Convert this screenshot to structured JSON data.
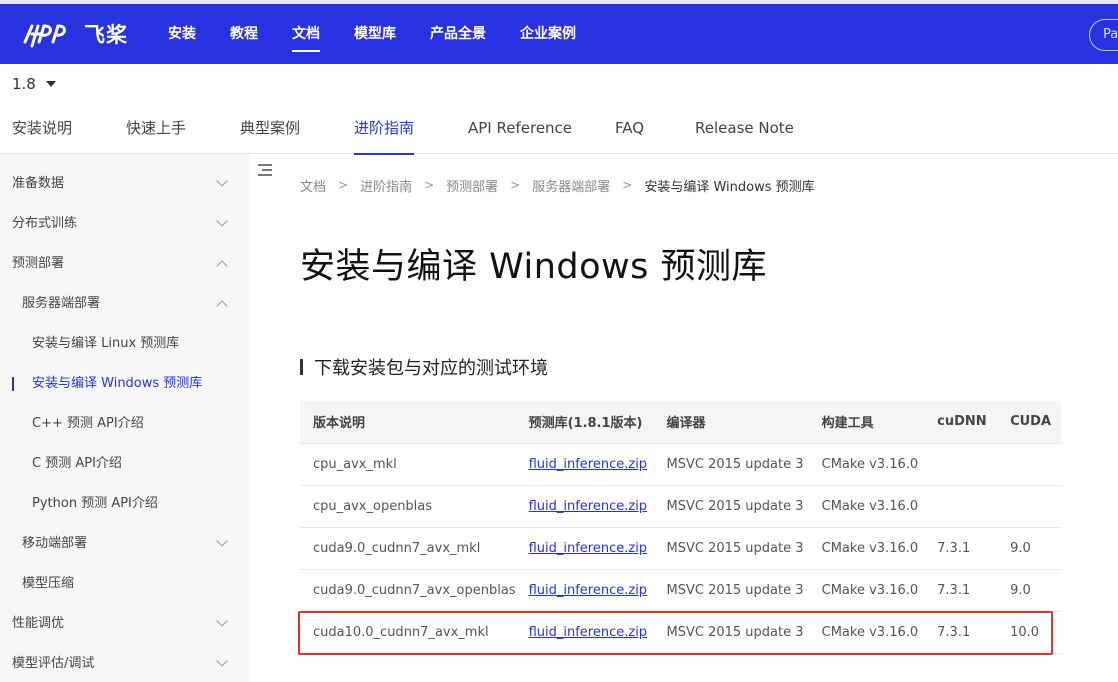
{
  "brand": {
    "logo_text": "飞桨"
  },
  "topnav": {
    "items": [
      {
        "label": "安装"
      },
      {
        "label": "教程"
      },
      {
        "label": "文档"
      },
      {
        "label": "模型库"
      },
      {
        "label": "产品全景"
      },
      {
        "label": "企业案例"
      }
    ],
    "active": "文档",
    "search_placeholder": "Pa"
  },
  "version": {
    "selected": "1.8"
  },
  "tabs": {
    "items": [
      {
        "label": "安装说明"
      },
      {
        "label": "快速上手"
      },
      {
        "label": "典型案例"
      },
      {
        "label": "进阶指南"
      },
      {
        "label": "API Reference"
      },
      {
        "label": "FAQ"
      },
      {
        "label": "Release Note"
      }
    ],
    "active": "进阶指南"
  },
  "sidebar": {
    "items": [
      {
        "label": "准备数据",
        "level": 1,
        "expanded": false
      },
      {
        "label": "分布式训练",
        "level": 1,
        "expanded": false
      },
      {
        "label": "预测部署",
        "level": 1,
        "expanded": true
      },
      {
        "label": "服务器端部署",
        "level": 2,
        "expanded": true
      },
      {
        "label": "安装与编译 Linux 预测库",
        "level": 3
      },
      {
        "label": "安装与编译 Windows 预测库",
        "level": 3,
        "active": true
      },
      {
        "label": "C++ 预测 API介绍",
        "level": 3
      },
      {
        "label": "C 预测 API介绍",
        "level": 3
      },
      {
        "label": "Python 预测 API介绍",
        "level": 3
      },
      {
        "label": "移动端部署",
        "level": 2,
        "expanded": false
      },
      {
        "label": "模型压缩",
        "level": 2
      },
      {
        "label": "性能调优",
        "level": 1,
        "expanded": false
      },
      {
        "label": "模型评估/调试",
        "level": 1,
        "expanded": false
      }
    ]
  },
  "breadcrumb": [
    "文档",
    "进阶指南",
    "预测部署",
    "服务器端部署",
    "安装与编译 Windows 预测库"
  ],
  "page": {
    "title": "安装与编译 Windows 预测库",
    "section_title": "下载安装包与对应的测试环境"
  },
  "table": {
    "headers": [
      "版本说明",
      "预测库(1.8.1版本)",
      "编译器",
      "构建工具",
      "cuDNN",
      "CUDA"
    ],
    "rows": [
      [
        "cpu_avx_mkl",
        "fluid_inference.zip",
        "MSVC 2015 update 3",
        "CMake v3.16.0",
        "",
        ""
      ],
      [
        "cpu_avx_openblas",
        "fluid_inference.zip",
        "MSVC 2015 update 3",
        "CMake v3.16.0",
        "",
        ""
      ],
      [
        "cuda9.0_cudnn7_avx_mkl",
        "fluid_inference.zip",
        "MSVC 2015 update 3",
        "CMake v3.16.0",
        "7.3.1",
        "9.0"
      ],
      [
        "cuda9.0_cudnn7_avx_openblas",
        "fluid_inference.zip",
        "MSVC 2015 update 3",
        "CMake v3.16.0",
        "7.3.1",
        "9.0"
      ],
      [
        "cuda10.0_cudnn7_avx_mkl",
        "fluid_inference.zip",
        "MSVC 2015 update 3",
        "CMake v3.16.0",
        "7.3.1",
        "10.0"
      ]
    ],
    "highlighted_row": 4
  },
  "colors": {
    "brand": "#2932e1",
    "highlight": "#e8302b"
  }
}
